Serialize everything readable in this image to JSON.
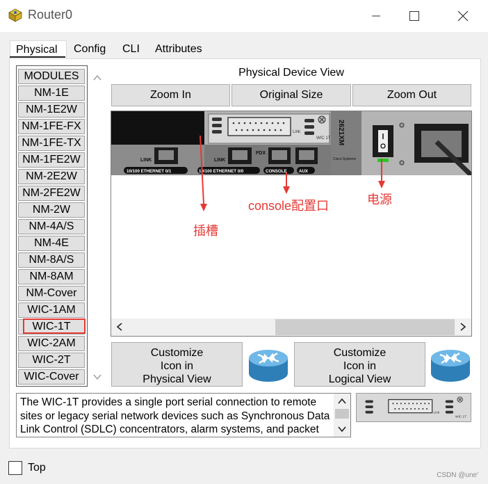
{
  "window": {
    "title": "Router0"
  },
  "tabs": [
    {
      "label": "Physical",
      "active": true
    },
    {
      "label": "Config",
      "active": false
    },
    {
      "label": "CLI",
      "active": false
    },
    {
      "label": "Attributes",
      "active": false
    }
  ],
  "modules": {
    "items": [
      "MODULES",
      "NM-1E",
      "NM-1E2W",
      "NM-1FE-FX",
      "NM-1FE-TX",
      "NM-1FE2W",
      "NM-2E2W",
      "NM-2FE2W",
      "NM-2W",
      "NM-4A/S",
      "NM-4E",
      "NM-8A/S",
      "NM-8AM",
      "NM-Cover",
      "WIC-1AM",
      "WIC-1T",
      "WIC-2AM",
      "WIC-2T",
      "WIC-Cover"
    ],
    "selected": "WIC-1T"
  },
  "device_view": {
    "label": "Physical Device View",
    "zoom_in": "Zoom In",
    "original_size": "Original Size",
    "zoom_out": "Zoom Out",
    "router": {
      "port_link_1": "LINK",
      "port_label_1": "10/100 ETHERNET 0/1",
      "port_link_0": "LINK",
      "port_label_0": "10/100 ETHERNET 0/0",
      "fdx": "FDX",
      "console": "CONSOLE",
      "aux": "AUX",
      "model": "2621XM",
      "brand": "Cisco Systems",
      "wic_slot": "W0",
      "wic_link": "Link",
      "wic_name": "WIC 1T"
    },
    "annotations": {
      "slot": "插槽",
      "console": "console配置口",
      "power": "电源"
    }
  },
  "customize": {
    "physical": [
      "Customize",
      "Icon in",
      "Physical View"
    ],
    "logical": [
      "Customize",
      "Icon in",
      "Logical View"
    ]
  },
  "description": {
    "lines": [
      "The WIC-1T provides a single port serial connection to remote",
      "sites or legacy serial network devices such as Synchronous Data",
      "Link Control (SDLC) concentrators, alarm systems, and packet"
    ],
    "module_link": "Link",
    "module_name": "WIC 1T"
  },
  "footer": {
    "top_label": "Top",
    "top_checked": false,
    "watermark": "CSDN @une'"
  },
  "colors": {
    "annotation": "#e53935",
    "selection": "#e53935",
    "power_led": "#28c828"
  }
}
